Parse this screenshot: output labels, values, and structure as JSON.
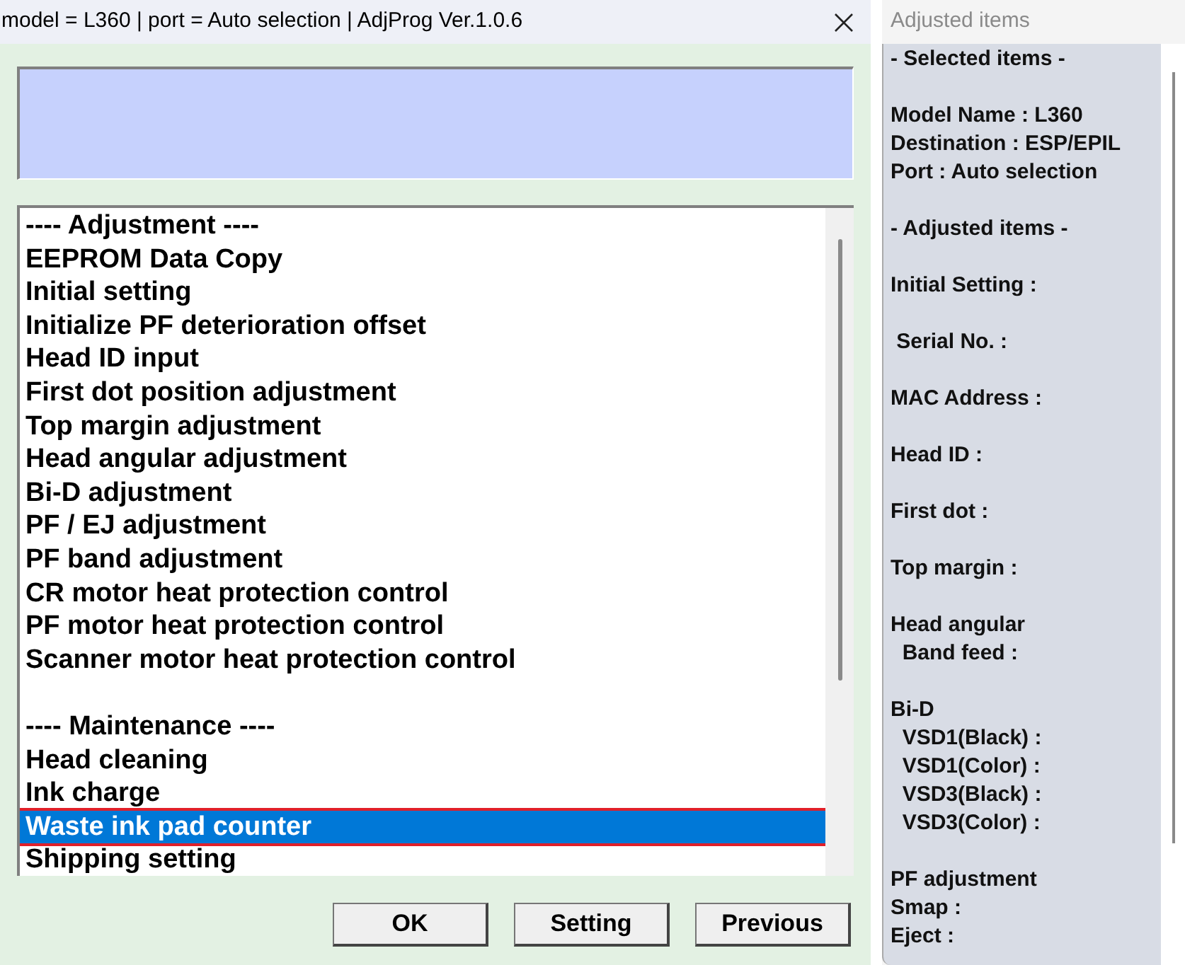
{
  "window": {
    "title": "model = L360 | port = Auto selection | AdjProg Ver.1.0.6"
  },
  "list": {
    "groups": [
      {
        "items": [
          {
            "label": "---- Adjustment ----",
            "selected": false
          },
          {
            "label": "EEPROM Data Copy",
            "selected": false
          },
          {
            "label": "Initial setting",
            "selected": false
          },
          {
            "label": "Initialize PF deterioration offset",
            "selected": false
          },
          {
            "label": "Head ID input",
            "selected": false
          },
          {
            "label": "First dot position adjustment",
            "selected": false
          },
          {
            "label": "Top margin adjustment",
            "selected": false
          },
          {
            "label": "Head angular adjustment",
            "selected": false
          },
          {
            "label": "Bi-D adjustment",
            "selected": false
          },
          {
            "label": "PF / EJ adjustment",
            "selected": false
          },
          {
            "label": "PF band adjustment",
            "selected": false
          },
          {
            "label": "CR motor heat protection control",
            "selected": false
          },
          {
            "label": "PF motor heat protection control",
            "selected": false
          },
          {
            "label": "Scanner motor heat protection control",
            "selected": false
          }
        ]
      },
      {
        "items": [
          {
            "label": "---- Maintenance ----",
            "selected": false
          },
          {
            "label": "Head cleaning",
            "selected": false
          },
          {
            "label": "Ink charge",
            "selected": false
          },
          {
            "label": "Waste ink pad counter",
            "selected": true
          },
          {
            "label": "Shipping setting",
            "selected": false
          }
        ]
      }
    ]
  },
  "buttons": [
    "OK",
    "Setting",
    "Previous"
  ],
  "side_panel": {
    "title": "Adjusted items",
    "groups": [
      [
        "- Selected items -"
      ],
      [
        "Model Name : L360",
        "Destination : ESP/EPIL",
        "Port : Auto selection"
      ],
      [
        "- Adjusted items -"
      ],
      [
        "Initial Setting :"
      ],
      [
        " Serial No. :"
      ],
      [
        "MAC Address :"
      ],
      [
        "Head ID :"
      ],
      [
        "First dot :"
      ],
      [
        "Top margin :"
      ],
      [
        "Head angular",
        "  Band feed :"
      ],
      [
        "Bi-D",
        "  VSD1(Black) :",
        "  VSD1(Color) :",
        "  VSD3(Black) :",
        "  VSD3(Color) :"
      ],
      [
        "PF adjustment",
        "Smap :",
        "Eject :"
      ]
    ]
  }
}
